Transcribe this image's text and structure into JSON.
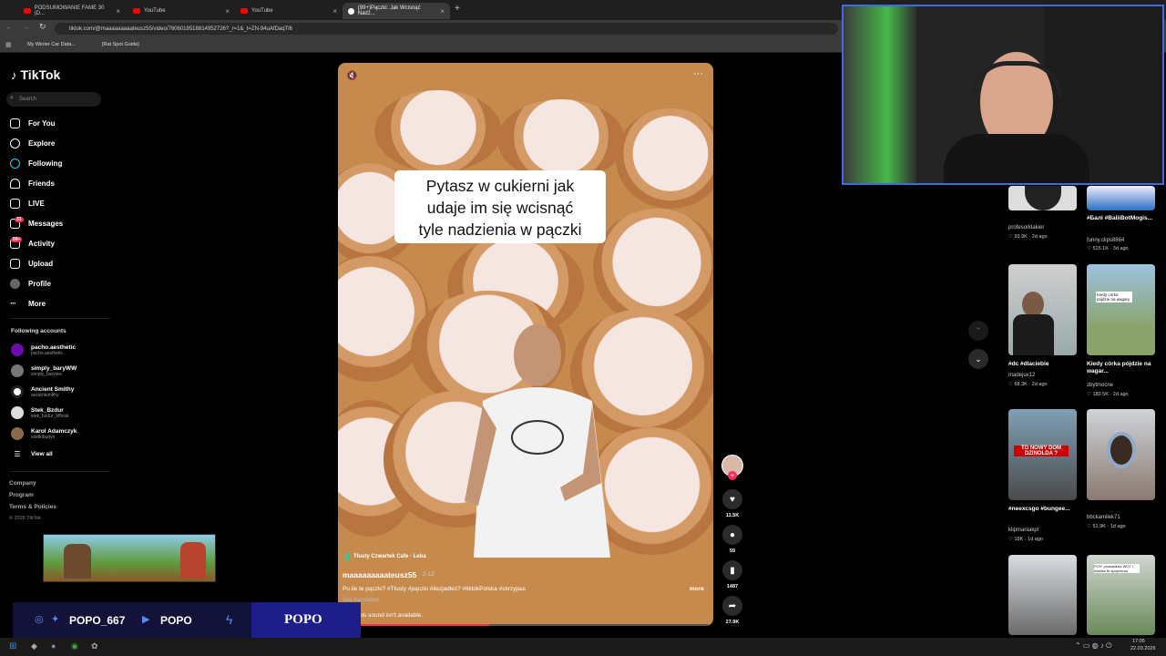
{
  "tabs": [
    {
      "label": "PODSUMOWANIE FAME 30 (D..."
    },
    {
      "label": "YouTube"
    },
    {
      "label": "YouTube"
    },
    {
      "label": "(99+)Pączki: Jak Wcisnąć Nadz..."
    }
  ],
  "address": "tiktok.com/@maaaaaaaaateusz55/video/7606018518814952726?_r=1&_t=ZN-94uAfDaqTl6",
  "bookmarks": [
    "My Winter Car Data...",
    "[Rat Spot Guide]"
  ],
  "logo": "TikTok",
  "search_placeholder": "Search",
  "nav": [
    "For You",
    "Explore",
    "Following",
    "Friends",
    "LIVE",
    "Messages",
    "Activity",
    "Upload",
    "Profile",
    "More"
  ],
  "badges": {
    "messages": "31",
    "activity": "99+"
  },
  "following_heading": "Following accounts",
  "accounts": [
    {
      "name": "pacho.aesthetic",
      "handle": "pacho.aesthetic"
    },
    {
      "name": "simply_baryWW",
      "handle": "simply_baryww"
    },
    {
      "name": "Ancient Smithy",
      "handle": "ancientsmithy"
    },
    {
      "name": "Stek_Bzdur",
      "handle": "stek_bzdur_official"
    },
    {
      "name": "Karol Adamczyk",
      "handle": "slodkibudyn"
    }
  ],
  "view_all": "View all",
  "footer": [
    "Company",
    "Program",
    "Terms & Policies",
    "© 2026 TikTok"
  ],
  "video": {
    "caption_lines": [
      "Pytasz w cukierni jak",
      "udaje im się wcisnąć",
      "tyle nadzienia w pączki"
    ],
    "cafe": "Tłusty Czwartek Cafe · Łeba",
    "author": "maaaaaaaaateusz55",
    "date": "2-12",
    "desc": "Po ile te pączki? #Tłusty #pączki #ilezjadłeś? #tiktokPolska #skrzypas",
    "more": "more",
    "translation": "See translation",
    "sound": "This sound isn't available.",
    "progress": 0.4
  },
  "actions": {
    "likes": "11.5K",
    "comments": "59",
    "saves": "1487",
    "shares": "27.9K"
  },
  "side_videos": [
    {
      "title": "",
      "user": "profesorklakier",
      "likes": "93.9K",
      "age": "2d ago"
    },
    {
      "title": "#Балі #BaliiBotMogis...",
      "user": "funny.clips8864",
      "likes": "515.1K",
      "age": "3d ago"
    },
    {
      "title": "#dc #dlaciebie",
      "user": "madejux12",
      "likes": "68.3K",
      "age": "2d ago"
    },
    {
      "title": "Kiedy córka pójdzie na wagar...",
      "user": "zbytmocne",
      "likes": "180.5K",
      "age": "2d ago"
    },
    {
      "title": "#neexcsgo #bungee...",
      "user": "klipmaniakpl",
      "likes": "18K",
      "age": "1d ago"
    },
    {
      "title": "",
      "user": "bbckamilek71",
      "likes": "51.9K",
      "age": "1d ago"
    }
  ],
  "thumb_texts": {
    "t4": "Kiedy córka pójdzie na wagary",
    "t5": "TO NOWY DOM DZINOLDA ?",
    "t8": "POV: prowadzisz WOT i widzisz te spojrzenia"
  },
  "stream": {
    "social": "POPO_667",
    "yt": "POPO",
    "brand": "POPO"
  },
  "clock": {
    "time": "17:05",
    "date": "22.03.2026"
  }
}
